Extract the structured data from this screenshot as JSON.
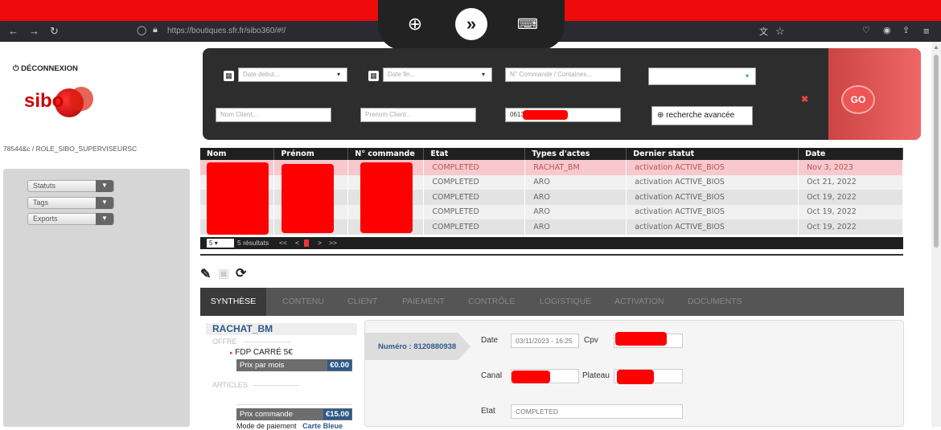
{
  "browser": {
    "url": "https://boutiques.sfr.fr/sibo360/#!/"
  },
  "sidebar": {
    "logout": "DÉCONNEXION",
    "logo_text": "sibo",
    "user_role": "78544&c / ROLE_SIBO_SUPERVISEURSC",
    "menus": [
      "Statuts",
      "Tags",
      "Exports"
    ]
  },
  "search": {
    "date_debut_placeholder": "Date debut...",
    "date_fin_placeholder": "Date fin...",
    "commande_placeholder": "N° Commande / Containes...",
    "nom_placeholder": "Nom Client...",
    "prenom_placeholder": "Prenom Client...",
    "phone_value": "0613",
    "advanced_label": "recherche avancée",
    "go_label": "GO"
  },
  "table": {
    "headers": [
      "Nom",
      "Prénom",
      "N° commande",
      "Etat",
      "Types d'actes",
      "Dernier statut",
      "Date"
    ],
    "rows": [
      {
        "etat": "COMPLETED",
        "type": "RACHAT_BM",
        "statut": "activation ACTIVE_BIOS",
        "date": "Nov 3, 2023"
      },
      {
        "etat": "COMPLETED",
        "type": "ARO",
        "statut": "activation ACTIVE_BIOS",
        "date": "Oct 21, 2022"
      },
      {
        "etat": "COMPLETED",
        "type": "ARO",
        "statut": "activation ACTIVE_BIOS",
        "date": "Oct 19, 2022"
      },
      {
        "etat": "COMPLETED",
        "type": "ARO",
        "statut": "activation ACTIVE_BIOS",
        "date": "Oct 19, 2022"
      },
      {
        "etat": "COMPLETED",
        "type": "ARO",
        "statut": "activation ACTIVE_BIOS",
        "date": "Oct 19, 2022"
      }
    ],
    "page_size": "5",
    "result_count": "5 résultats",
    "pager_first": "<<",
    "pager_prev": "<",
    "pager_next": ">",
    "pager_last": ">>"
  },
  "tabs": [
    "SYNTHÈSE",
    "CONTENU",
    "CLIENT",
    "PAIEMENT",
    "CONTRÔLE",
    "LOGISTIQUE",
    "ACTIVATION",
    "DOCUMENTS"
  ],
  "synthese": {
    "title": "RACHAT_BM",
    "offre_label": "OFFRE",
    "offre_item": "FDP CARRÉ 5€",
    "prix_mois_label": "Prix par mois",
    "prix_mois_value": "€0.00",
    "articles_label": "ARTICLES",
    "prix_commande_label": "Prix commande",
    "prix_commande_value": "€15.00",
    "mode_paiement_label": "Mode de paiement",
    "mode_paiement_value": "Carte Bleue",
    "numero": "Numéro : 8120880938",
    "date_label": "Date",
    "date_value": "03/11/2023 - 16:25",
    "cpv_label": "Cpv",
    "canal_label": "Canal",
    "plateau_label": "Plateau",
    "etat_label": "Etat",
    "etat_value": "COMPLETED"
  },
  "colors": {
    "accent_red": "#ee0a0a",
    "selected_row": "#f7c8cd",
    "header_dark": "#1f1f1f"
  }
}
